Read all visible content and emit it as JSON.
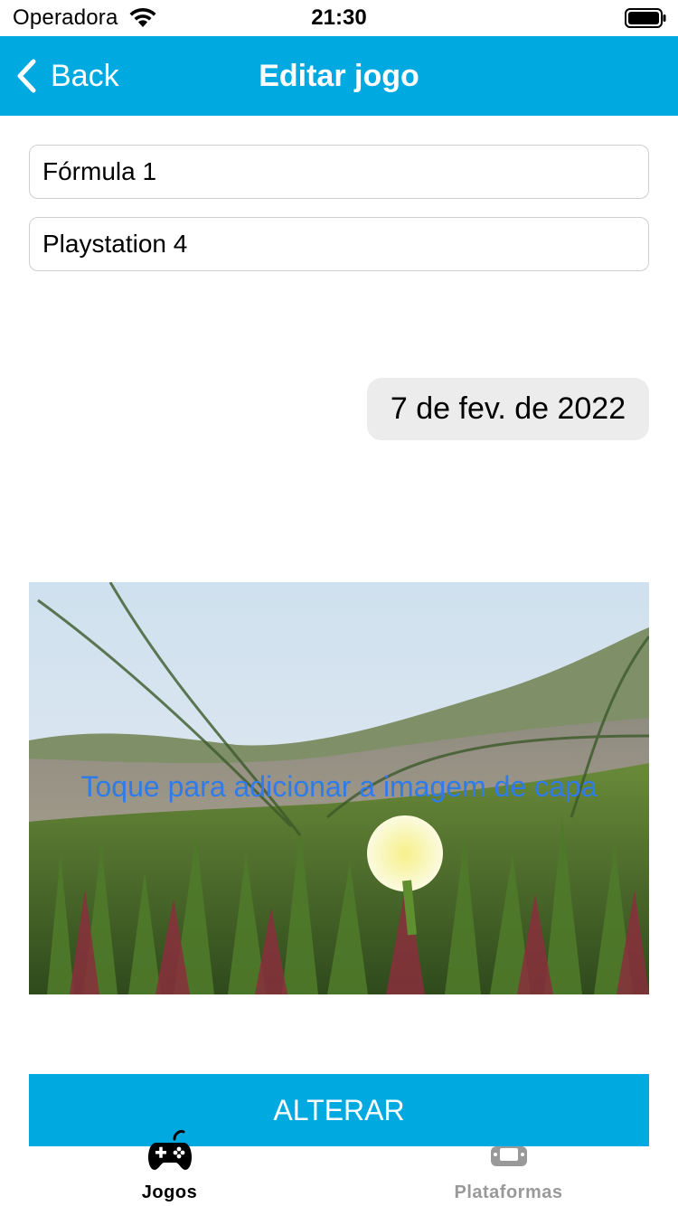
{
  "status_bar": {
    "carrier": "Operadora",
    "time": "21:30"
  },
  "nav": {
    "back_label": "Back",
    "title": "Editar jogo"
  },
  "form": {
    "name_value": "Fórmula 1",
    "platform_value": "Playstation 4",
    "date_value": "7 de fev. de 2022",
    "cover_hint": "Toque para adicionar a imagem de capa",
    "submit_label": "ALTERAR"
  },
  "tabs": [
    {
      "label": "Jogos",
      "icon": "gamepad-icon",
      "selected": true
    },
    {
      "label": "Plataformas",
      "icon": "handheld-console-icon",
      "selected": false
    }
  ],
  "colors": {
    "accent": "#00a9e0",
    "cover_hint": "#2f7bea",
    "tab_selected": "#000000",
    "tab_unselected": "#999999"
  }
}
